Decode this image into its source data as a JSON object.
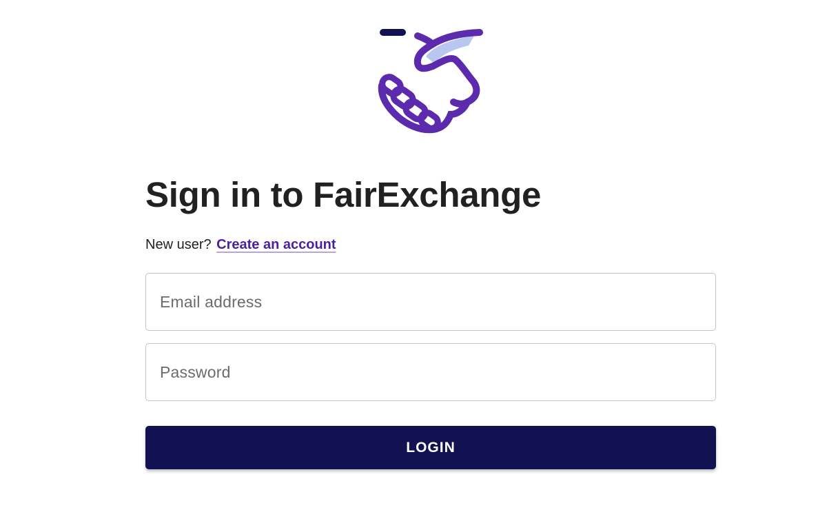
{
  "brand": {
    "logo_icon": "handshake-icon",
    "primary_color": "#121152",
    "accent_color": "#5b2aad",
    "highlight_color": "#b9c6f0"
  },
  "heading": {
    "title": "Sign in to FairExchange"
  },
  "signup": {
    "prompt": "New user?",
    "link_label": "Create an account"
  },
  "form": {
    "email_placeholder": "Email address",
    "email_value": "",
    "password_placeholder": "Password",
    "password_value": "",
    "login_label": "LOGIN"
  }
}
